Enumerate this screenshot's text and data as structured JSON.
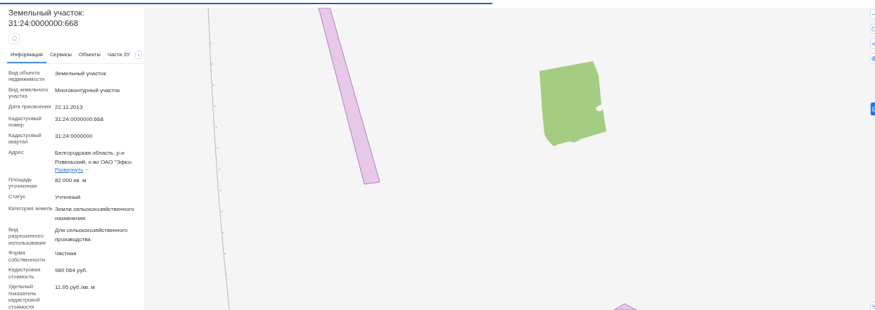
{
  "panel": {
    "title": "Земельный участок:",
    "number": "31:24:0000000:668",
    "favorite": false
  },
  "tabs": [
    {
      "label": "Информация",
      "selected": true
    },
    {
      "label": "Сервисы",
      "selected": false
    },
    {
      "label": "Объекты",
      "selected": false
    },
    {
      "label": "Части ЗУ",
      "selected": false
    }
  ],
  "tab_scroll": "›",
  "fields": [
    {
      "label": "Вид объекта недвижимости",
      "value": "Земельный участок"
    },
    {
      "label": "Вид земельного участка",
      "value": "Многоконтурный участок"
    },
    {
      "label": "Дата присвоения",
      "value": "22.11.2013"
    },
    {
      "label": "Кадастровый номер",
      "value": "31:24:0000000:668"
    },
    {
      "label": "Кадастровый квартал",
      "value": "31:24:0000000"
    },
    {
      "label": "Адрес",
      "value": "Белгородская область, р-н Ровеньский, х-во ОАО \"Эфко-",
      "expand": "Развернуть"
    },
    {
      "label": "Площадь уточненная",
      "value": "82 000 кв. м"
    },
    {
      "label": "Статус",
      "value": "Учтенный"
    },
    {
      "label": "Категория земель",
      "value": "Земли сельскохозяйственного назначения"
    },
    {
      "label": "Вид разрешенного использования",
      "value": "Для сельскохозяйственного производства"
    },
    {
      "label": "Форма собственности",
      "value": "Частная"
    },
    {
      "label": "Кадастровая стоимость",
      "value": "980 064 руб."
    },
    {
      "label": "Удельный показатель кадастровой стоимости",
      "value": "11,95 руб./кв. м"
    }
  ]
}
